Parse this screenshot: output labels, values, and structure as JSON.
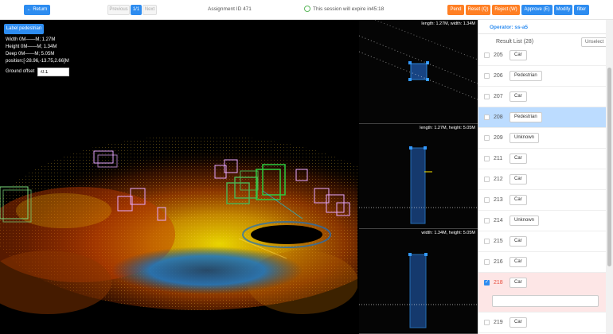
{
  "topbar": {
    "return_label": "← Return",
    "previous_label": "Previous",
    "page_label": "1/1",
    "next_label": "Next",
    "assignment": "Assignment ID 471",
    "expire_text": "This session will expire in",
    "expire_time": "45:18",
    "actions": [
      "Pend",
      "Reset (Q)",
      "Reject (W)",
      "Approve (E)",
      "Modify",
      "filter"
    ]
  },
  "scene": {
    "label_button": "Label pedestrian",
    "width_text": "Width 0M——M; 1.27M",
    "height_text": "Height 0M——M; 1.34M",
    "deep_text": "Deep 0M——M; 5.05M",
    "position_text": "position:[-28.96,-13.75,2.66]M",
    "ground_offset_label": "Ground offset",
    "ground_offset_value": "-0.1"
  },
  "views": [
    {
      "label": "length: 1.27M, width: 1.34M"
    },
    {
      "label": "length: 1.27M, height: 5.05M"
    },
    {
      "label": "width: 1.34M, height: 5.05M"
    }
  ],
  "panel": {
    "operator": "Operator: ss-a5",
    "result_list": "Result List (28)",
    "unselect": "Unselect",
    "items": [
      {
        "id": "205",
        "label": "Car"
      },
      {
        "id": "206",
        "label": "Pedestrian"
      },
      {
        "id": "207",
        "label": "Car"
      },
      {
        "id": "208",
        "label": "Pedestrian"
      },
      {
        "id": "209",
        "label": "Unknown"
      },
      {
        "id": "211",
        "label": "Car"
      },
      {
        "id": "212",
        "label": "Car"
      },
      {
        "id": "213",
        "label": "Car"
      },
      {
        "id": "214",
        "label": "Unknown"
      },
      {
        "id": "215",
        "label": "Car"
      },
      {
        "id": "216",
        "label": "Car"
      },
      {
        "id": "218",
        "label": "Car"
      },
      {
        "id": "219",
        "label": "Car"
      }
    ]
  },
  "colors": {
    "primary": "#2d8cf0",
    "action": "#ff7f24",
    "selected_row": "#bcdcff",
    "checked_row": "#fde6e6"
  }
}
